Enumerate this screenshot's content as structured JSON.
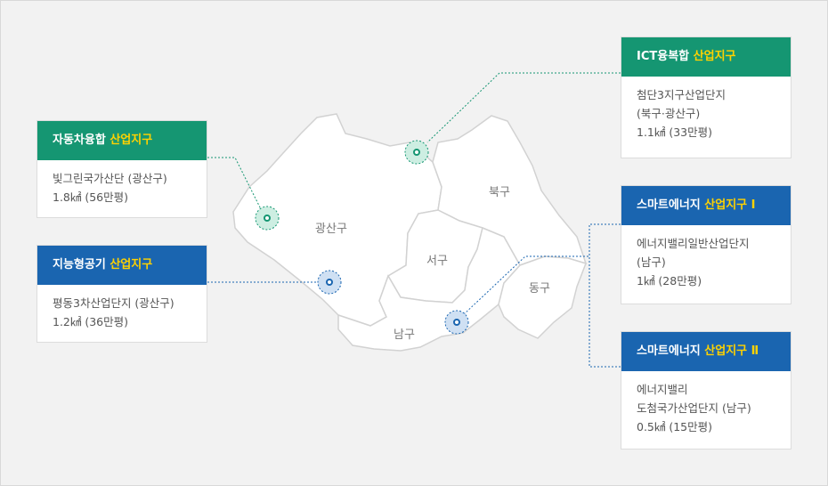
{
  "districts": {
    "gwangsan": "광산구",
    "buk": "북구",
    "seo": "서구",
    "nam": "남구",
    "dong": "동구"
  },
  "colors": {
    "green": "#159672",
    "blue": "#1a65b0",
    "highlight": "#ffd200"
  },
  "cards": [
    {
      "name": "card-ict",
      "color": "green",
      "title": "ICT융복합 ",
      "title_highlight": "산업지구",
      "lines": [
        "첨단3지구산업단지",
        "(북구·광산구)",
        "1.1㎢ (33만평)"
      ]
    },
    {
      "name": "card-auto",
      "color": "green",
      "title": "자동차융합 ",
      "title_highlight": "산업지구",
      "lines": [
        "빛그린국가산단 (광산구)",
        "1.8㎢ (56만평)"
      ]
    },
    {
      "name": "card-smart-machine",
      "color": "blue",
      "title": "지능형공기 ",
      "title_highlight": "산업지구",
      "lines": [
        "평동3차산업단지 (광산구)",
        "1.2㎢ (36만평)"
      ]
    },
    {
      "name": "card-smart-energy-1",
      "color": "blue",
      "title": "스마트에너지 ",
      "title_highlight": "산업지구 Ⅰ",
      "lines": [
        "에너지밸리일반산업단지",
        "(남구)",
        "1㎢ (28만평)"
      ]
    },
    {
      "name": "card-smart-energy-2",
      "color": "blue",
      "title": "스마트에너지 ",
      "title_highlight": "산업지구 Ⅱ",
      "lines": [
        "에너지밸리",
        "도첨국가산업단지 (남구)",
        "0.5㎢ (15만평)"
      ]
    }
  ]
}
